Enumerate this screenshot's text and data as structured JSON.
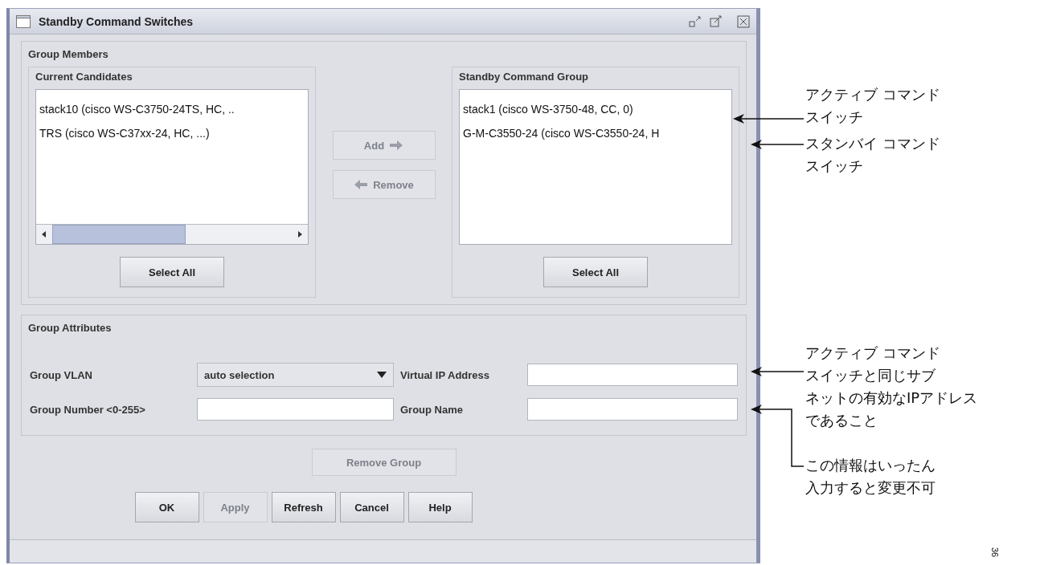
{
  "window": {
    "title": "Standby Command Switches"
  },
  "group_members": {
    "title": "Group Members",
    "current_candidates": {
      "title": "Current Candidates",
      "items": [
        "stack10 (cisco WS-C3750-24TS, HC, ..",
        "TRS (cisco WS-C37xx-24, HC, ...)"
      ],
      "select_all": "Select All"
    },
    "add_button": {
      "label": "Add",
      "disabled": true
    },
    "remove_button": {
      "label": "Remove",
      "disabled": true
    },
    "standby_group": {
      "title": "Standby Command Group",
      "items": [
        "stack1 (cisco WS-3750-48, CC, 0)",
        "G-M-C3550-24 (cisco WS-C3550-24, H"
      ],
      "select_all": "Select All"
    }
  },
  "group_attributes": {
    "title": "Group Attributes",
    "fields": [
      {
        "kind": "dropdown",
        "label": "Group VLAN",
        "value": "auto selection"
      },
      {
        "kind": "text",
        "label": "Virtual IP Address"
      },
      {
        "kind": "text",
        "label": "Group Number <0-255>"
      },
      {
        "kind": "text",
        "label": "Group Name"
      }
    ]
  },
  "remove_group": {
    "label": "Remove Group",
    "disabled": true
  },
  "buttons": [
    {
      "label": "OK",
      "disabled": false
    },
    {
      "label": "Apply",
      "disabled": true
    },
    {
      "label": "Refresh",
      "disabled": false
    },
    {
      "label": "Cancel",
      "disabled": false
    },
    {
      "label": "Help",
      "disabled": false
    }
  ],
  "callouts": [
    {
      "lines": [
        "アクティブ コマンド",
        "スイッチ"
      ]
    },
    {
      "lines": [
        "スタンバイ コマンド",
        "スイッチ"
      ]
    },
    {
      "lines": [
        "アクティブ コマンド",
        "スイッチと同じサブ",
        "ネットの有効なIPアドレス",
        "であること"
      ]
    },
    {
      "lines": [
        "この情報はいったん",
        "入力すると変更不可"
      ]
    }
  ],
  "figure_id": "36"
}
